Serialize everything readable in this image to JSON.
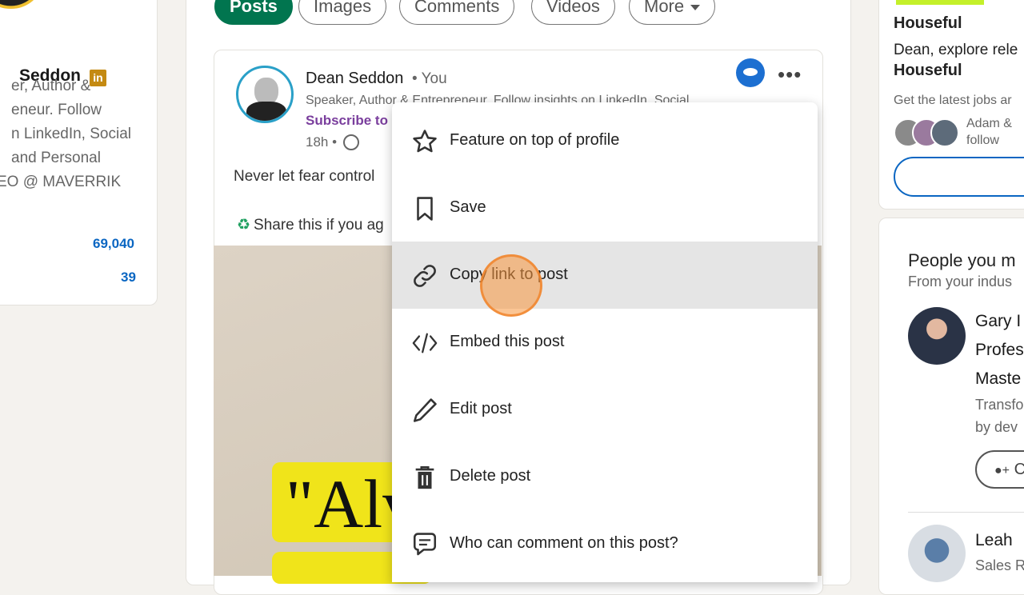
{
  "left_profile": {
    "name": "Seddon",
    "badge": "in",
    "headline_lines": [
      "er, Author &",
      "eneur. Follow",
      "n LinkedIn, Social",
      "and Personal",
      "EO @ MAVERRIK"
    ],
    "stats": [
      "69,040",
      "39"
    ]
  },
  "tabs": [
    {
      "label": "Posts",
      "active": true
    },
    {
      "label": "Images"
    },
    {
      "label": "Comments"
    },
    {
      "label": "Videos"
    },
    {
      "label": "More"
    }
  ],
  "post": {
    "author_name": "Dean Seddon",
    "author_you": "• You",
    "headline": "Speaker, Author & Entrepreneur. Follow insights on LinkedIn, Social",
    "subscribe": "Subscribe to",
    "time": "18h •",
    "text": "Never let fear control",
    "share_line": "Share this if you ag",
    "recycle_glyph": "♻",
    "image_quote": "\"Alv",
    "more_glyph": "•••"
  },
  "menu": {
    "items": [
      {
        "label": "Feature on top of profile",
        "icon": "star-icon"
      },
      {
        "label": "Save",
        "icon": "bookmark-icon"
      },
      {
        "label": "Copy link to post",
        "icon": "link-icon",
        "hovered": true
      },
      {
        "label": "Embed this post",
        "icon": "code-icon"
      },
      {
        "label": "Edit post",
        "icon": "pencil-icon"
      },
      {
        "label": "Delete post",
        "icon": "trash-icon"
      },
      {
        "label": "Who can comment on this post?",
        "icon": "comment-icon"
      }
    ]
  },
  "right_ad": {
    "brand": "Houseful",
    "line1": "Dean, explore rele",
    "line2": "Houseful",
    "line3": "Get the latest jobs ar",
    "follow_text_1": "Adam &",
    "follow_text_2": "follow"
  },
  "pymk": {
    "title": "People you m",
    "subtitle": "From your indus",
    "person1": {
      "lines": [
        "Gary I",
        "Profes",
        "Maste"
      ],
      "desc": [
        "Transfo",
        "by dev"
      ],
      "connect_label": "C"
    },
    "person2": {
      "name": "Leah",
      "desc": "Sales R"
    }
  },
  "colors": {
    "accent_green": "#01754f",
    "link_blue": "#0a66c2",
    "premium_gold": "#c48a12",
    "menu_hover": "#e5e5e5"
  }
}
